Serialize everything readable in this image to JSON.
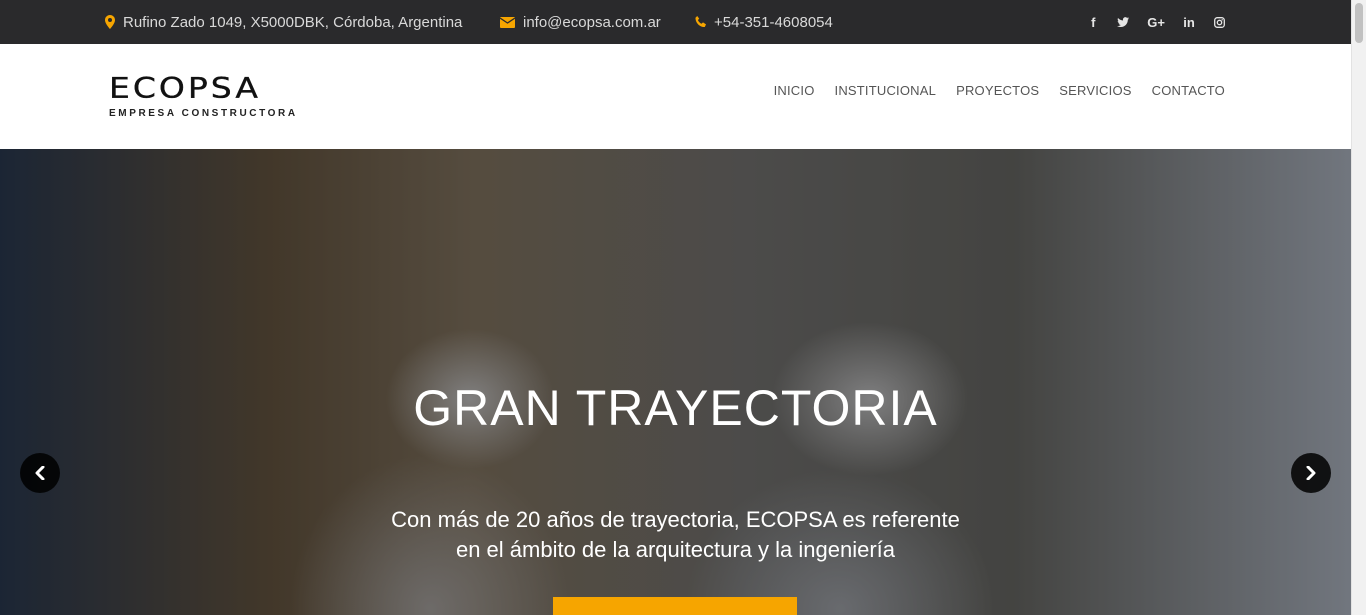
{
  "topbar": {
    "address": "Rufino Zado 1049, X5000DBK, Córdoba, Argentina",
    "email": "info@ecopsa.com.ar",
    "phone": "+54-351-4608054",
    "icon_color": "#f6a500",
    "social": [
      {
        "name": "facebook-icon",
        "glyph": "f"
      },
      {
        "name": "twitter-icon",
        "glyph": "🐦"
      },
      {
        "name": "google-plus-icon",
        "glyph": "G+"
      },
      {
        "name": "linkedin-icon",
        "glyph": "in"
      },
      {
        "name": "instagram-icon",
        "glyph": "◎"
      }
    ]
  },
  "header": {
    "logo_word": "ECOPSA",
    "logo_sub": "EMPRESA CONSTRUCTORA",
    "nav": [
      "INICIO",
      "INSTITUCIONAL",
      "PROYECTOS",
      "SERVICIOS",
      "CONTACTO"
    ]
  },
  "hero": {
    "title": "GRAN TRAYECTORIA",
    "text_line1": "Con más de 20 años de trayectoria, ECOPSA es referente",
    "text_line2": "en el ámbito de la arquitectura y la ingeniería",
    "cta_color": "#f6a500"
  }
}
